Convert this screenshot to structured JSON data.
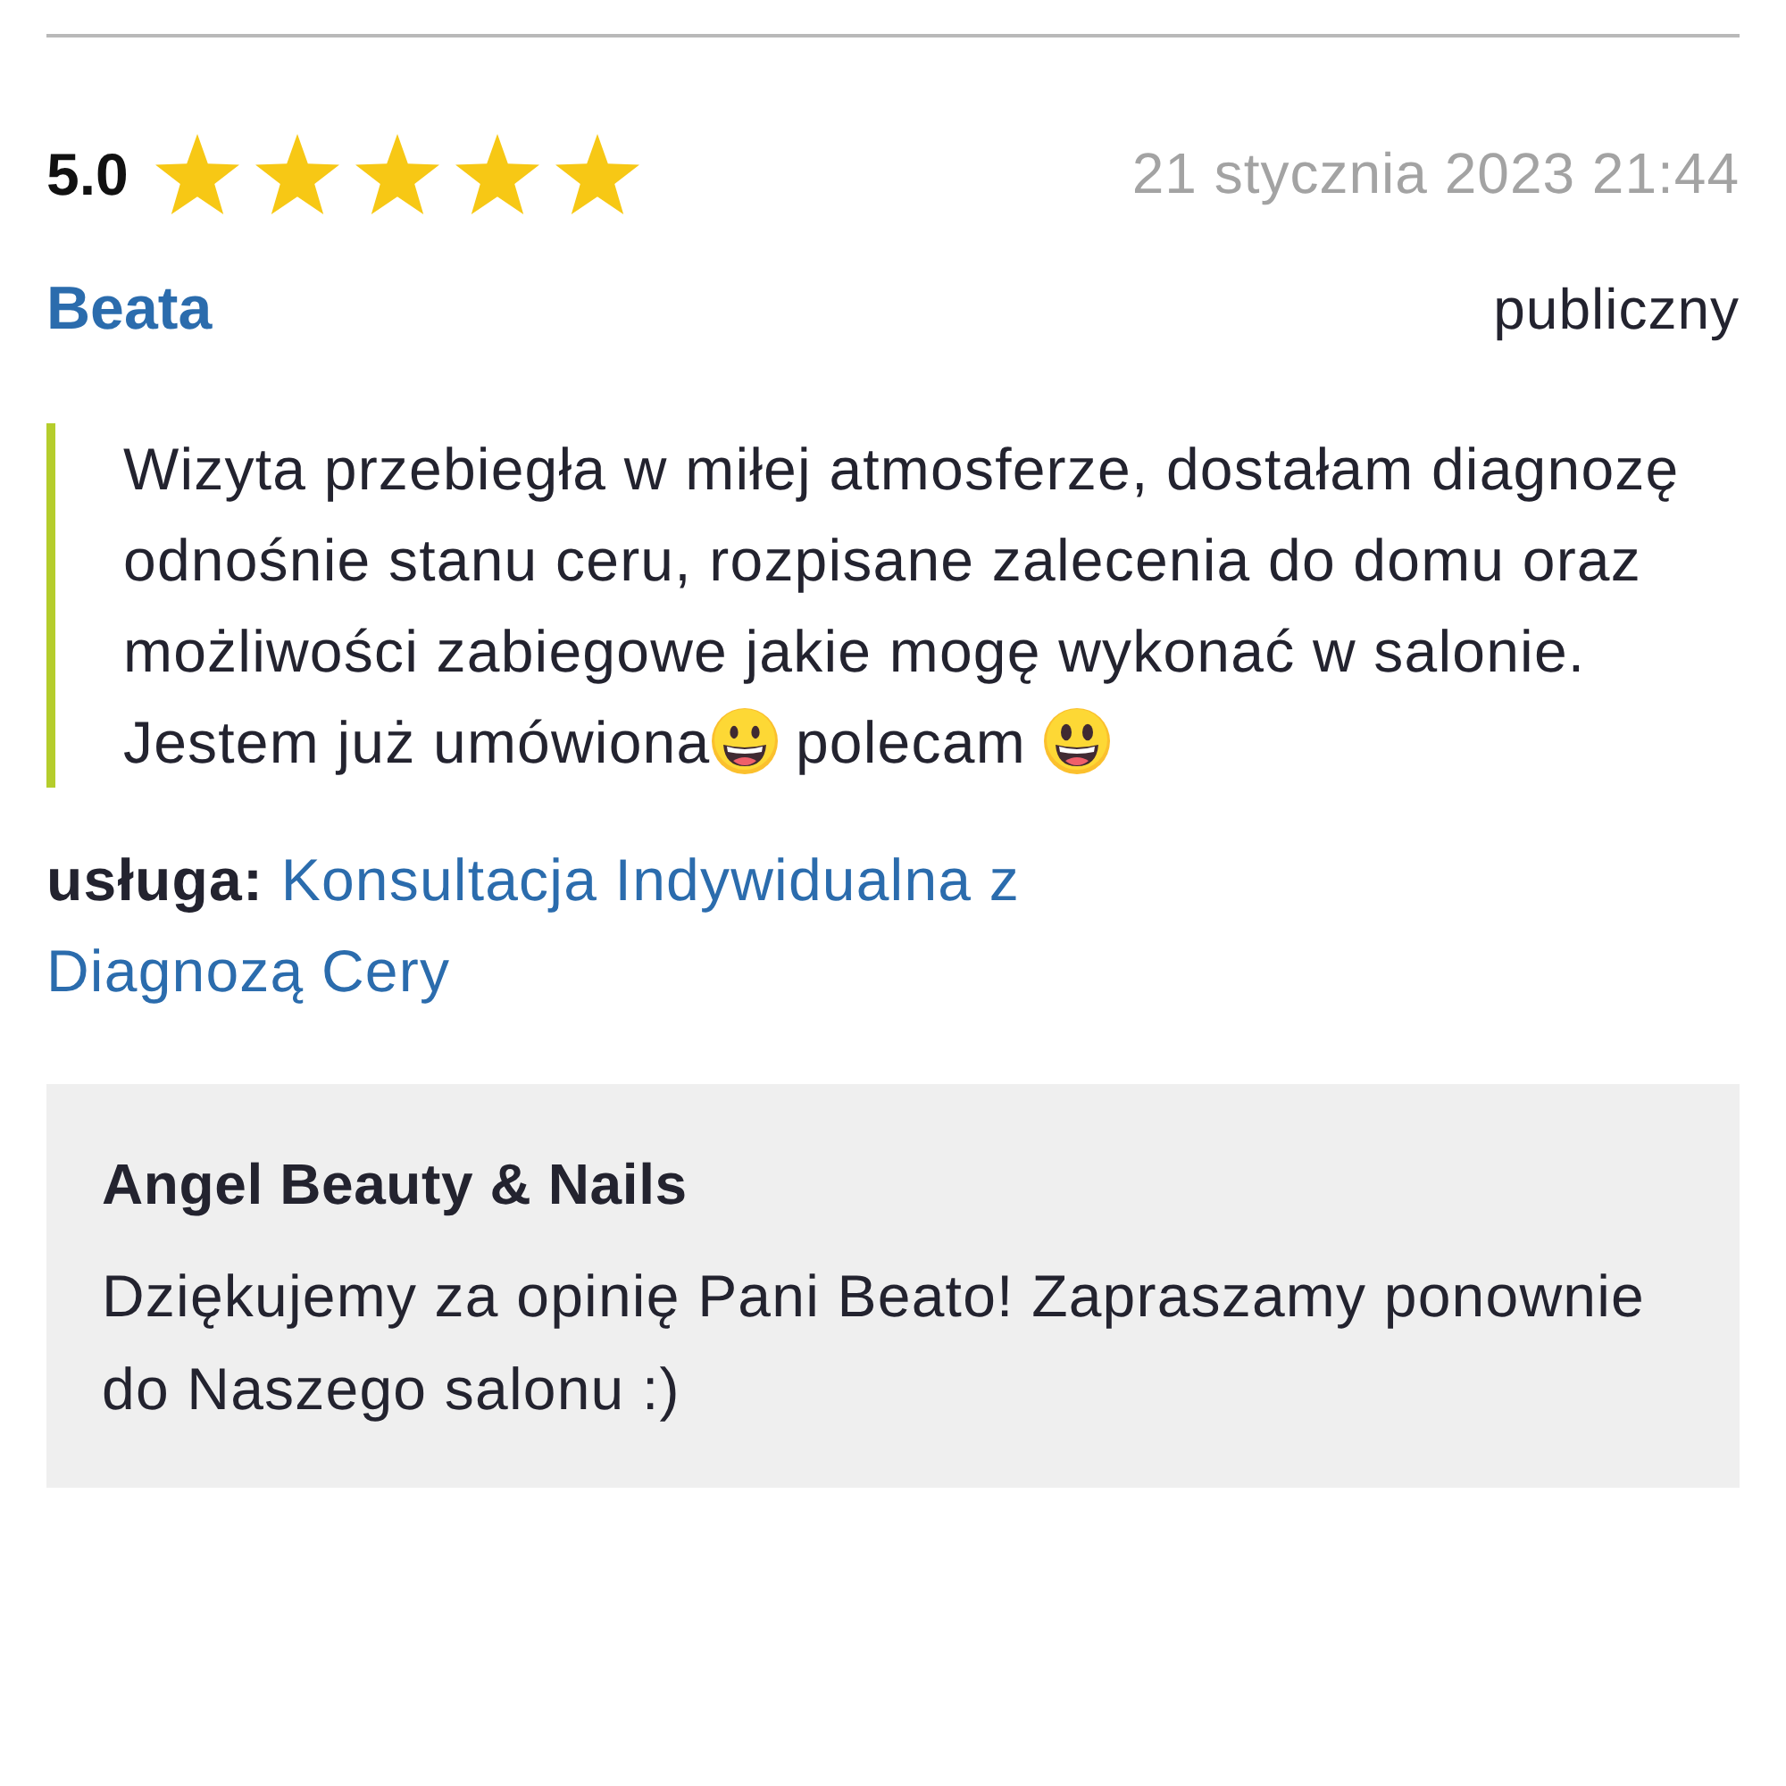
{
  "review": {
    "rating": "5.0",
    "stars": 5,
    "date": "21 stycznia 2023 21:44",
    "author": "Beata",
    "visibility": "publiczny",
    "body": [
      {
        "kind": "text",
        "text": "Wizyta przebiegła w miłej atmosferze, dostałam diagnozę odnośnie stanu ceru, rozpisane zalecenia do domu oraz możliwości zabiegowe jakie mogę wykonać w salonie. Jestem już umówiona"
      },
      {
        "kind": "grinning-face"
      },
      {
        "kind": "text",
        "text": " polecam "
      },
      {
        "kind": "smiley-face"
      }
    ],
    "service_label": "usługa:",
    "service": "Konsultacja Indywidualna z Diagnozą Cery"
  },
  "reply": {
    "author": "Angel Beauty & Nails",
    "text": "Dziękujemy za opinię Pani Beato! Zapraszamy ponownie do Naszego salonu :)"
  }
}
